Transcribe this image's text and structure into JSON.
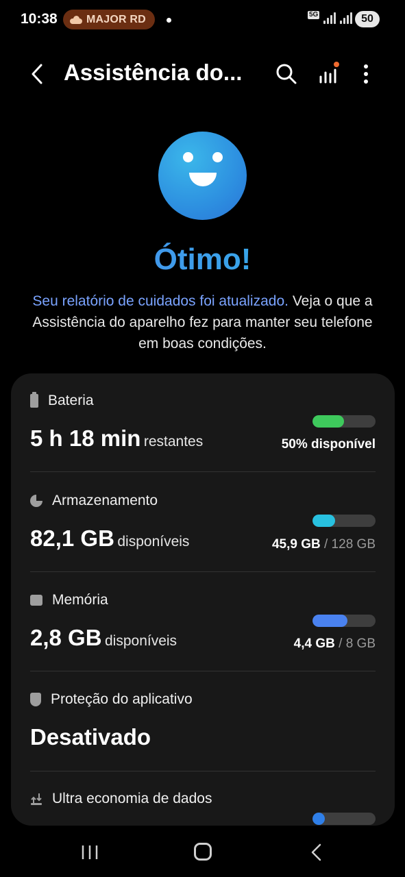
{
  "status_bar": {
    "time": "10:38",
    "media_label": "MAJOR RD",
    "network": "5G",
    "battery_level": "50"
  },
  "header": {
    "title": "Assistência do..."
  },
  "hero": {
    "status": "Ótimo!",
    "report_link": "Seu relatório de cuidados foi atualizado.",
    "report_text": " Veja o que a Assistência do aparelho fez para manter seu telefone em boas condições."
  },
  "items": {
    "battery": {
      "label": "Bateria",
      "value": "5 h 18 min",
      "unit": "restantes",
      "meta": "50% disponível",
      "level": 0.5,
      "color": "#3ec95c"
    },
    "storage": {
      "label": "Armazenamento",
      "value": "82,1 GB",
      "unit": "disponíveis",
      "used": "45,9 GB",
      "total": "/ 128 GB",
      "level": 0.36,
      "color": "#28c1e0"
    },
    "memory": {
      "label": "Memória",
      "value": "2,8 GB",
      "unit": "disponíveis",
      "used": "4,4 GB",
      "total": "/ 8 GB",
      "level": 0.55,
      "color": "#4a82f0"
    },
    "app_protection": {
      "label": "Proteção do aplicativo",
      "value": "Desativado"
    },
    "data_saver": {
      "label": "Ultra economia de dados",
      "level": 0.2,
      "color": "#2f7fe8"
    }
  },
  "colors": {
    "background": "#000000",
    "card": "#181818",
    "accent_link": "#7aa3ff",
    "track": "#3e3e3e"
  }
}
